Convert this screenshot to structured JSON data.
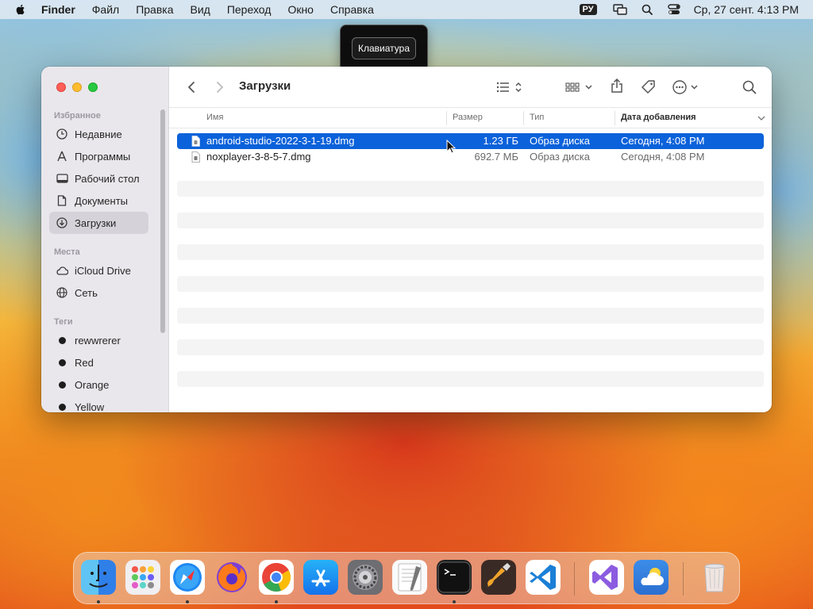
{
  "menubar": {
    "app_name": "Finder",
    "items": [
      "Файл",
      "Правка",
      "Вид",
      "Переход",
      "Окно",
      "Справка"
    ],
    "input_source": "РУ",
    "clock": "Ср, 27 сент.  4:13 PM",
    "icons": [
      "apple-icon",
      "screen-mirroring-icon",
      "spotlight-search-icon",
      "control-center-icon"
    ]
  },
  "keyboard_popup": {
    "label": "Клавиатура"
  },
  "window": {
    "title": "Загрузки",
    "sidebar": {
      "favorites_header": "Избранное",
      "favorites": [
        {
          "label": "Недавние",
          "icon": "clock-icon"
        },
        {
          "label": "Программы",
          "icon": "applications-icon"
        },
        {
          "label": "Рабочий стол",
          "icon": "desktop-icon"
        },
        {
          "label": "Документы",
          "icon": "document-icon"
        },
        {
          "label": "Загрузки",
          "icon": "downloads-icon",
          "active": true
        }
      ],
      "locations_header": "Места",
      "locations": [
        {
          "label": "iCloud Drive",
          "icon": "cloud-icon"
        },
        {
          "label": "Сеть",
          "icon": "network-icon"
        }
      ],
      "tags_header": "Теги",
      "tags": [
        {
          "label": "rewwrerer",
          "color": "#1d1d1d"
        },
        {
          "label": "Red",
          "color": "#1d1d1d"
        },
        {
          "label": "Orange",
          "color": "#1d1d1d"
        },
        {
          "label": "Yellow",
          "color": "#1d1d1d"
        }
      ]
    },
    "columns": {
      "name": "Имя",
      "size": "Размер",
      "kind": "Тип",
      "date_added": "Дата добавления"
    },
    "files": [
      {
        "name": "android-studio-2022-3-1-19.dmg",
        "size": "1.23 ГБ",
        "kind": "Образ диска",
        "date": "Сегодня, 4:08 PM",
        "selected": true
      },
      {
        "name": "noxplayer-3-8-5-7.dmg",
        "size": "692.7 МБ",
        "kind": "Образ диска",
        "date": "Сегодня, 4:08 PM",
        "selected": false
      }
    ]
  },
  "dock": {
    "apps": [
      "Finder",
      "Launchpad",
      "Safari",
      "Firefox",
      "Chrome",
      "App Store",
      "System Settings",
      "TextEdit",
      "Terminal",
      "GarageBand",
      "Visual Studio Code",
      "Visual Studio",
      "Weather",
      "Trash"
    ],
    "accent": "#0b62da"
  }
}
